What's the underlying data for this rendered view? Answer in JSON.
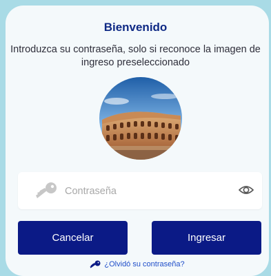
{
  "header": {
    "title": "Bienvenido",
    "subtitle": "Introduzca su contraseña, solo si reconoce la imagen de ingreso preseleccionado"
  },
  "login_image": {
    "icon": "colosseum-image"
  },
  "password": {
    "placeholder": "Contraseña",
    "value": "",
    "key_icon": "key-icon",
    "toggle_icon": "eye-icon"
  },
  "actions": {
    "cancel_label": "Cancelar",
    "login_label": "Ingresar"
  },
  "forgot": {
    "label": "¿Olvidó su contraseña?",
    "icon": "key-icon"
  },
  "colors": {
    "background": "#a9dbe6",
    "card": "#f4f9fb",
    "primary": "#0b1a86",
    "title": "#0f2a85",
    "link": "#1f4ec9"
  }
}
